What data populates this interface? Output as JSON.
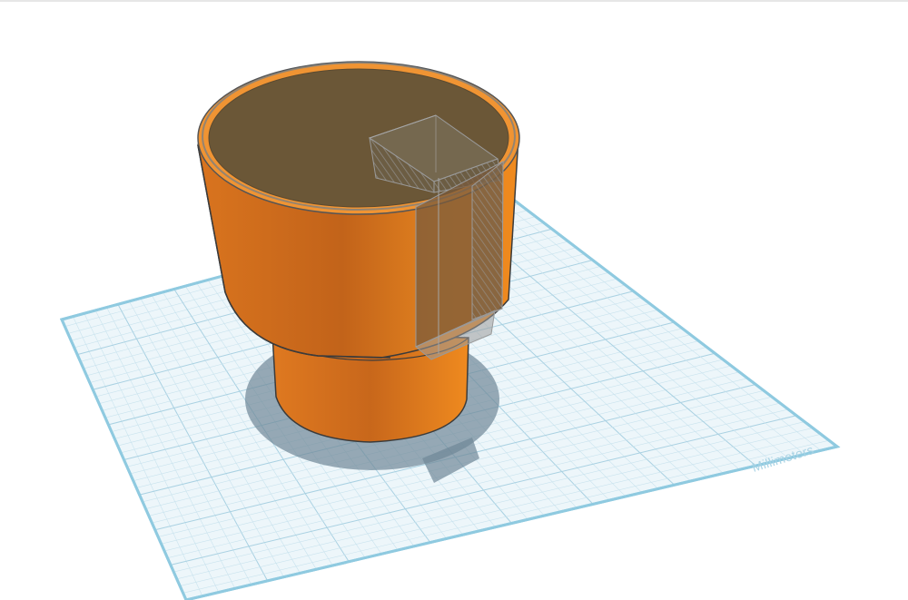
{
  "workplane": {
    "units_label": "Millimeters",
    "grid_color": "#c9e3ee",
    "major_grid_color": "#a9d1e2",
    "plane_color": "#eef6fa",
    "edge_color": "#8fcae0"
  },
  "model": {
    "body_color": "#e07a22",
    "hole_color": "#8a8a8a"
  }
}
